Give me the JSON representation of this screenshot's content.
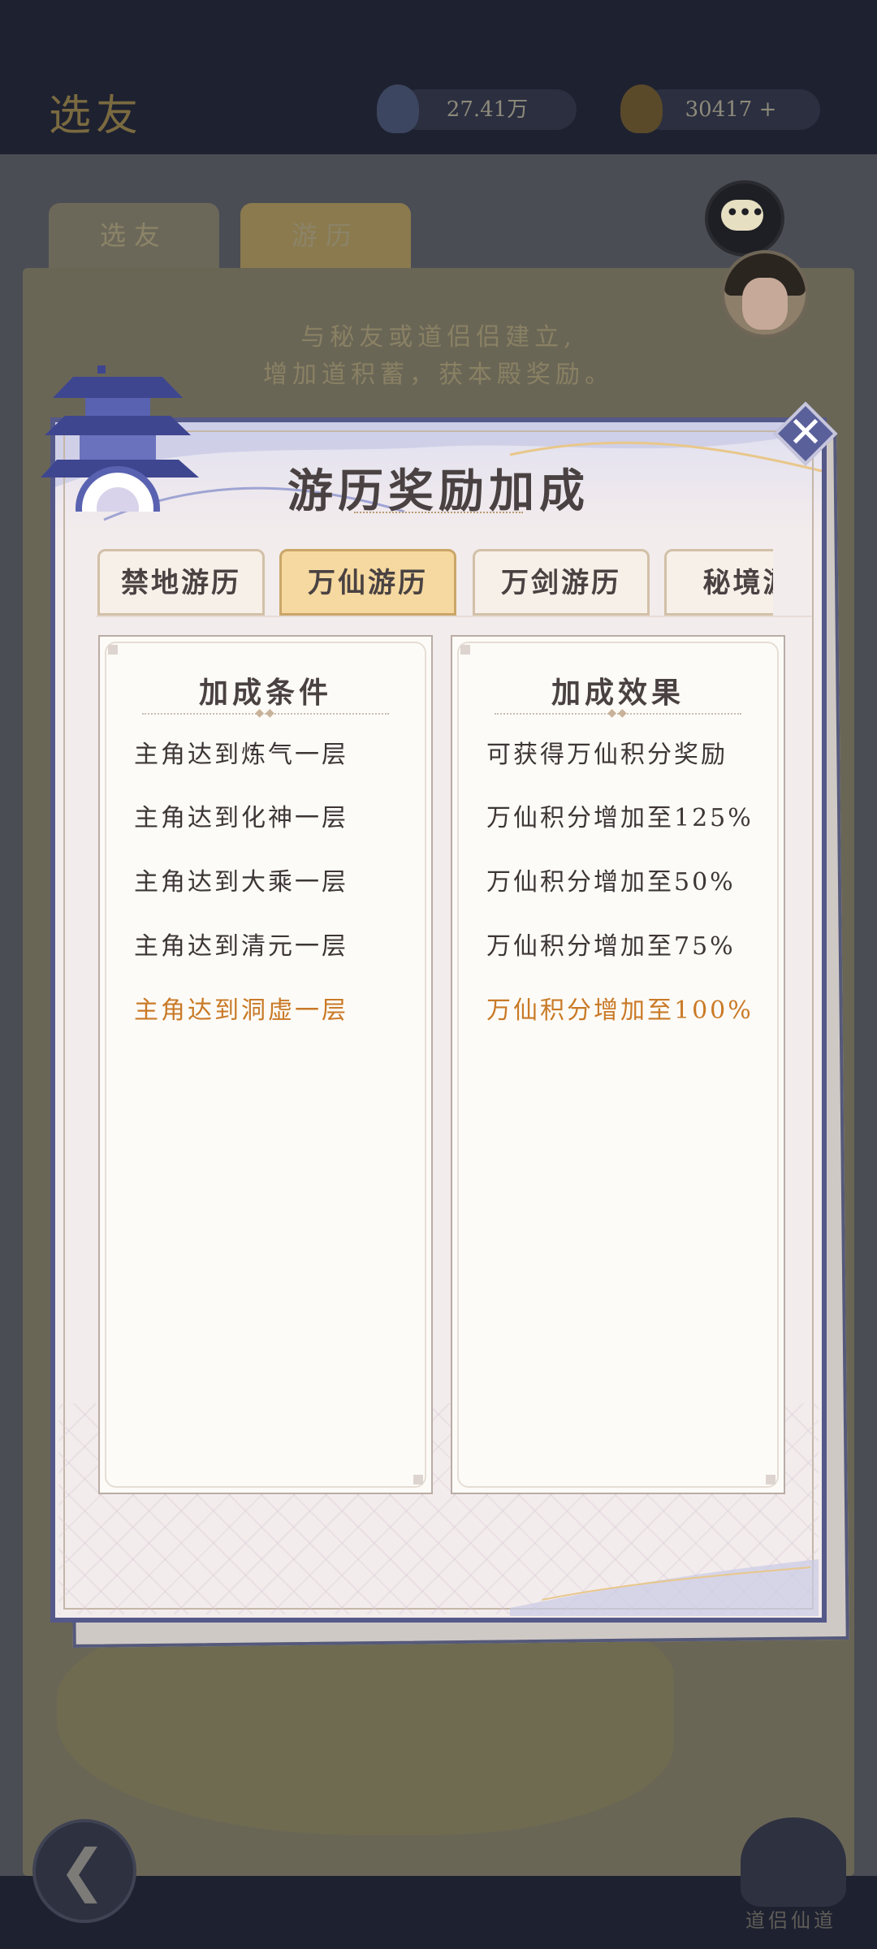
{
  "background": {
    "screen_title": "选友",
    "resource_1": "27.41万",
    "resource_2": "30417",
    "tab_1": "选友",
    "tab_2": "游历",
    "hint_line_1": "与秘友或道侣侣建立,",
    "hint_line_2": "增加道积蓄，获本殿奖励。",
    "bottom_right_label": "道侣仙道"
  },
  "modal": {
    "title": "游历奖励加成",
    "close_icon": "close-icon",
    "tabs": [
      {
        "label": "禁地游历",
        "active": false
      },
      {
        "label": "万仙游历",
        "active": true
      },
      {
        "label": "万剑游历",
        "active": false
      },
      {
        "label": "秘境游",
        "active": false
      }
    ],
    "conditions": {
      "header": "加成条件",
      "rows": [
        "主角达到炼气一层",
        "主角达到化神一层",
        "主角达到大乘一层",
        "主角达到清元一层",
        "主角达到洞虚一层"
      ]
    },
    "effects": {
      "header": "加成效果",
      "rows": [
        "可获得万仙积分奖励",
        "万仙积分增加至125%",
        "万仙积分增加至50%",
        "万仙积分增加至75%",
        "万仙积分增加至100%"
      ]
    },
    "highlight_color": "#c97a27",
    "frame_color": "#54598a"
  }
}
